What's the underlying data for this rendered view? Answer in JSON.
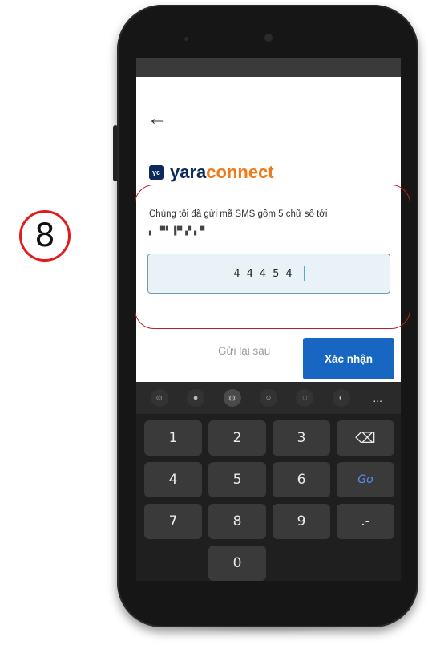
{
  "step": {
    "number": "8"
  },
  "app": {
    "back_icon": "back-arrow-icon",
    "logo_badge": "yc",
    "logo_part1": "yara",
    "logo_part2": "connect",
    "sms_message": "Chúng tôi đã gửi mã SMS gồm 5 chữ số tới",
    "masked_phone": "▖ ▀▘▐▀▗▘▖▀",
    "code_value": "44454",
    "resend_label": "Gửi lại sau",
    "confirm_label": "Xác nhận"
  },
  "keyboard": {
    "toolbar_icons": [
      "emoji-icon",
      "mic-icon",
      "settings-icon",
      "search-icon",
      "translate-icon",
      "theme-icon"
    ],
    "more_label": "...",
    "rows": [
      [
        "1",
        "2",
        "3",
        "⌫"
      ],
      [
        "4",
        "5",
        "6",
        "Go"
      ],
      [
        "7",
        "8",
        "9",
        ".-"
      ],
      [
        "",
        "0",
        "",
        ""
      ]
    ]
  },
  "colors": {
    "brand_navy": "#0b2a5b",
    "brand_orange": "#f07a1a",
    "primary_button": "#1767c2",
    "highlight_border": "#b4232a",
    "badge_circle": "#e01b1b"
  }
}
